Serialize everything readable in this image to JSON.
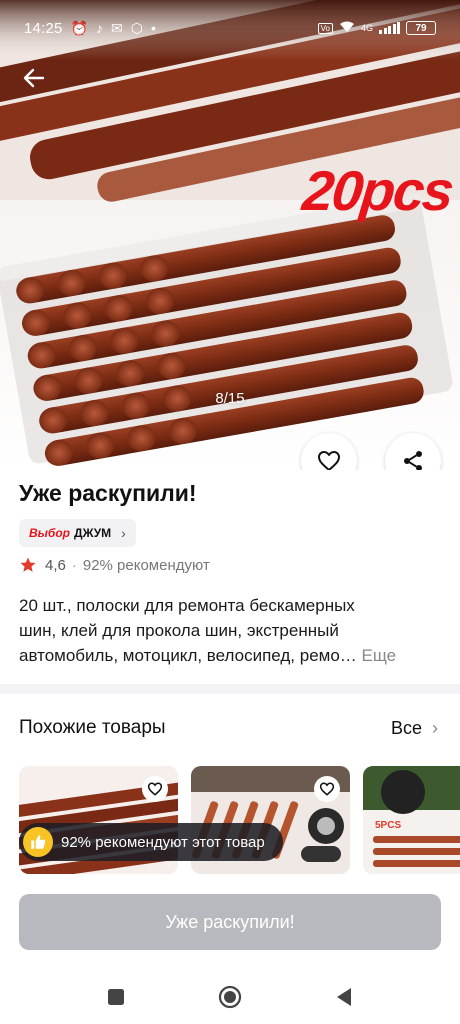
{
  "status_bar": {
    "time": "14:25",
    "network": "4G",
    "battery": "79",
    "icons": [
      "alarm-icon",
      "tiktok-icon",
      "mail-icon",
      "package-icon",
      "dot-icon",
      "volte-icon",
      "wifi-icon",
      "signal-icon",
      "battery-icon"
    ]
  },
  "gallery": {
    "badge_text": "20pcs",
    "counter": "8/15",
    "current_index": 8,
    "total": 15
  },
  "product": {
    "title": "Уже раскупили!",
    "store_tag": "Выбор",
    "store_name": "ДЖУМ",
    "rating": "4,6",
    "separator": "·",
    "recommend": "92% рекомендуют",
    "description_lines": [
      "20 шт., полоски для ремонта бескамерных",
      "шин, клей для прокола шин, экстренный",
      "автомобиль, мотоцикл, велосипед, ремо…"
    ],
    "more_label": "Еще"
  },
  "similar": {
    "heading": "Похожие товары",
    "all_label": "Все",
    "card3_tag": "5PCS",
    "recommend_pill": "92% рекомендуют этот товар"
  },
  "buy_button": {
    "label": "Уже раскупили!"
  },
  "colors": {
    "accent_red": "#e8141c",
    "disabled_button": "#b8b8bf",
    "star": "#e23b2b"
  }
}
